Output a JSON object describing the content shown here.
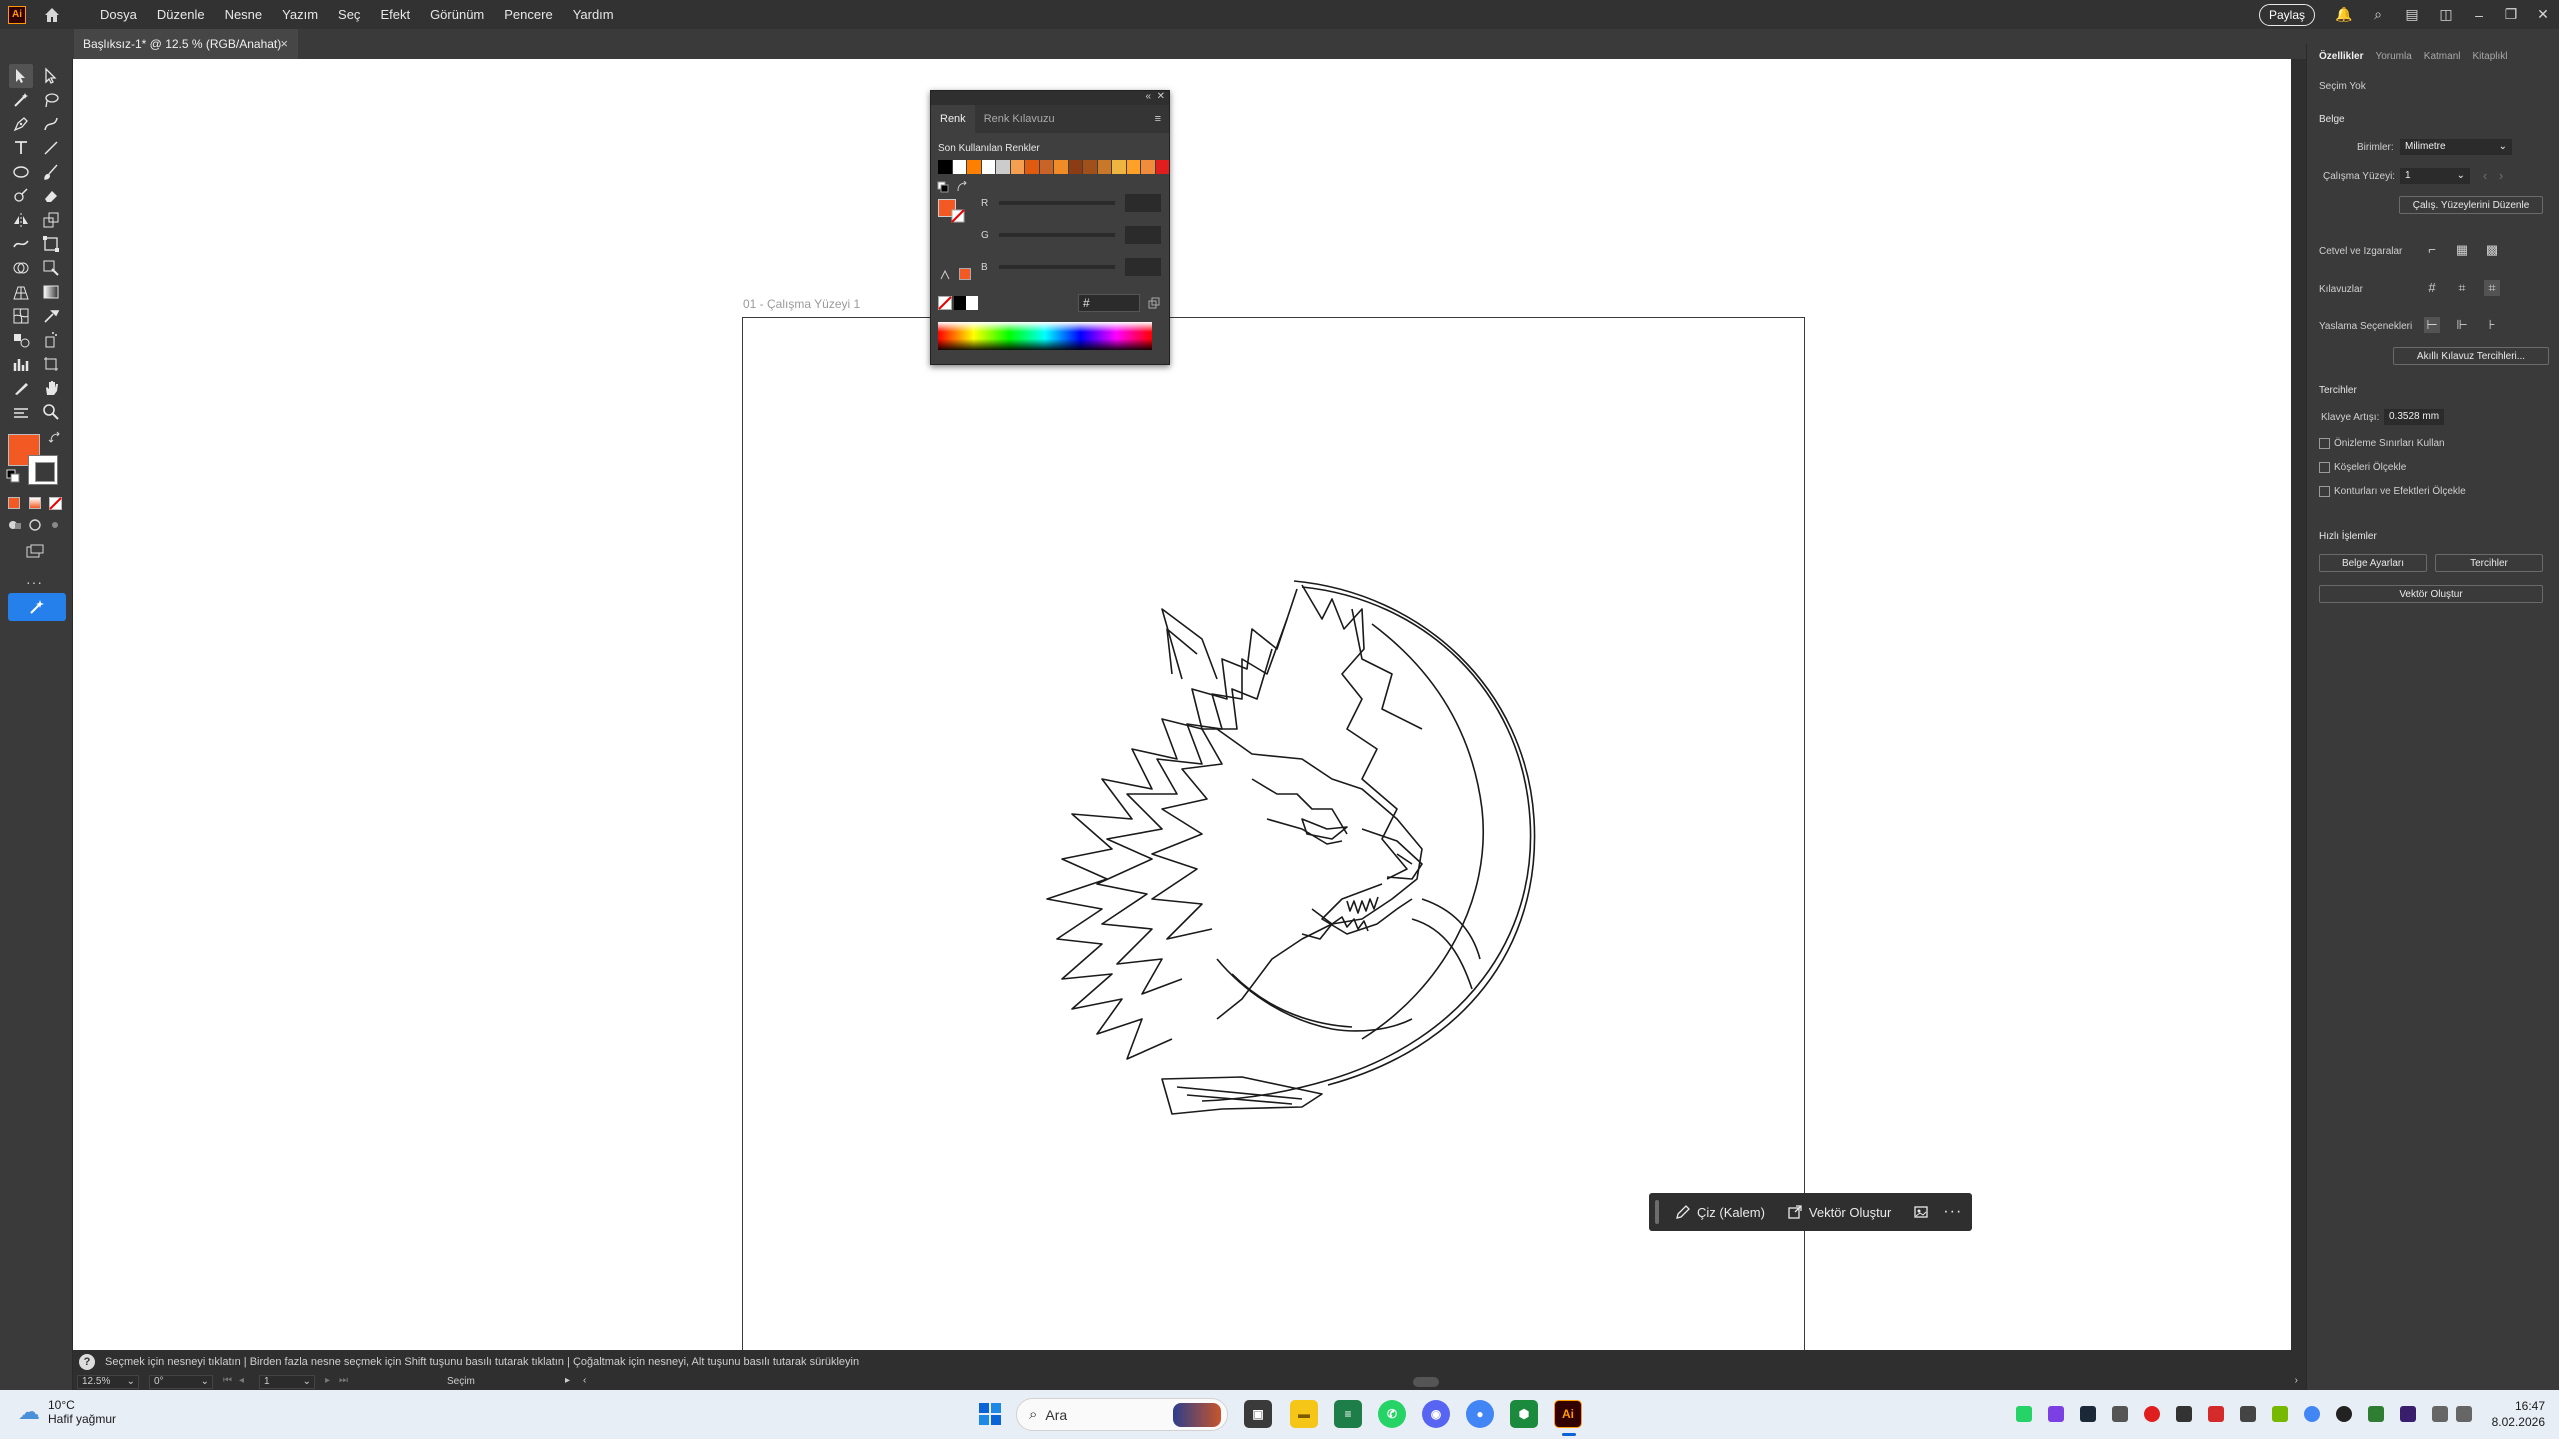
{
  "menubar": {
    "app_logo": "Ai",
    "menus": [
      "Dosya",
      "Düzenle",
      "Nesne",
      "Yazım",
      "Seç",
      "Efekt",
      "Görünüm",
      "Pencere",
      "Yardım"
    ],
    "share_label": "Paylaş"
  },
  "document": {
    "tab_title": "Başlıksız-1* @ 12.5 % (RGB/Anahat)",
    "artboard_label": "01 - Çalışma Yüzeyi 1"
  },
  "colors": {
    "fill": "#f35a23",
    "accent": "#2680eb"
  },
  "color_panel": {
    "tabs": [
      "Renk",
      "Renk Kılavuzu"
    ],
    "active_tab": "Renk",
    "recent_label": "Son Kullanılan Renkler",
    "recent_swatches": [
      "#000000",
      "#ffffff",
      "#ff7f00",
      "#ffffff",
      "#cccccc",
      "#f5a050",
      "#e05a10",
      "#c86428",
      "#f08c28",
      "#8c3c14",
      "#a05018",
      "#c87828",
      "#f0b440",
      "#ffa028",
      "#f08c3c",
      "#e01e1e"
    ],
    "channels": [
      "R",
      "G",
      "B"
    ],
    "hex_label": "#"
  },
  "context_bar": {
    "draw_label": "Çiz (Kalem)",
    "vector_label": "Vektör Oluştur"
  },
  "properties": {
    "tabs": [
      "Özellikler",
      "Yorumla",
      "Katmanl",
      "Kitaplıkl"
    ],
    "active_tab": "Özellikler",
    "selection": "Seçim Yok",
    "document_section": "Belge",
    "units_label": "Birimler:",
    "units_value": "Milimetre",
    "artboard_label": "Çalışma Yüzeyi:",
    "artboard_value": "1",
    "edit_artboards_btn": "Çalış. Yüzeylerini Düzenle",
    "rulers_grids": "Cetvel ve Izgaralar",
    "guides": "Kılavuzlar",
    "snap_options": "Yaslama Seçenekleri",
    "smart_guides_btn": "Akıllı Kılavuz Tercihleri...",
    "preferences_section": "Tercihler",
    "keyboard_increment_label": "Klavye Artışı:",
    "keyboard_increment_value": "0.3528 mm",
    "check_preview_bounds": "Önizleme Sınırları Kullan",
    "check_scale_corners": "Köşeleri Ölçekle",
    "check_scale_strokes": "Konturları ve Efektleri Ölçekle",
    "quick_actions": "Hızlı İşlemler",
    "doc_setup_btn": "Belge Ayarları",
    "prefs_btn": "Tercihler",
    "create_vector_btn": "Vektör Oluştur"
  },
  "statusbar": {
    "help_icon": "?",
    "hint": "Seçmek için nesneyi tıklatın  |  Birden fazla nesne seçmek için Shift tuşunu basılı tutarak tıklatın  |  Çoğaltmak için nesneyi, Alt tuşunu basılı tutarak sürükleyin",
    "zoom": "12.5%",
    "rotation": "0°",
    "artboard_num": "1",
    "tool_name": "Seçim"
  },
  "taskbar": {
    "temp": "10°C",
    "weather": "Hafif yağmur",
    "search_placeholder": "Ara",
    "time": "16:47",
    "date": "8.02.2026"
  }
}
